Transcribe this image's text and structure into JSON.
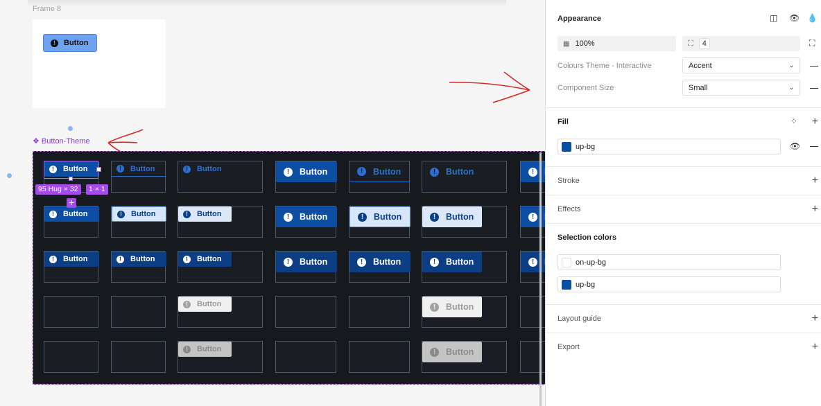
{
  "canvas": {
    "frame8_label": "Frame 8",
    "frame8_button_label": "Button",
    "component_label": "Button-Theme",
    "selection_size_badge": "95 Hug × 32",
    "selection_extra_badge": "1 × 1",
    "button_label": "Button",
    "icon_glyph": "!"
  },
  "panel": {
    "appearance": {
      "title": "Appearance",
      "opacity_value": "100%",
      "radius_value": "4",
      "colours_theme_label": "Colours Theme - Interactive",
      "colours_theme_value": "Accent",
      "component_size_label": "Component Size",
      "component_size_value": "Small"
    },
    "fill": {
      "title": "Fill",
      "items": [
        {
          "name": "up-bg",
          "color": "#0b4ea2"
        }
      ]
    },
    "stroke": {
      "title": "Stroke"
    },
    "effects": {
      "title": "Effects"
    },
    "selection_colors": {
      "title": "Selection colors",
      "items": [
        {
          "name": "on-up-bg",
          "color": "#ffffff"
        },
        {
          "name": "up-bg",
          "color": "#0b4ea2"
        }
      ]
    },
    "layout_guide": {
      "title": "Layout guide"
    },
    "export": {
      "title": "Export"
    }
  }
}
